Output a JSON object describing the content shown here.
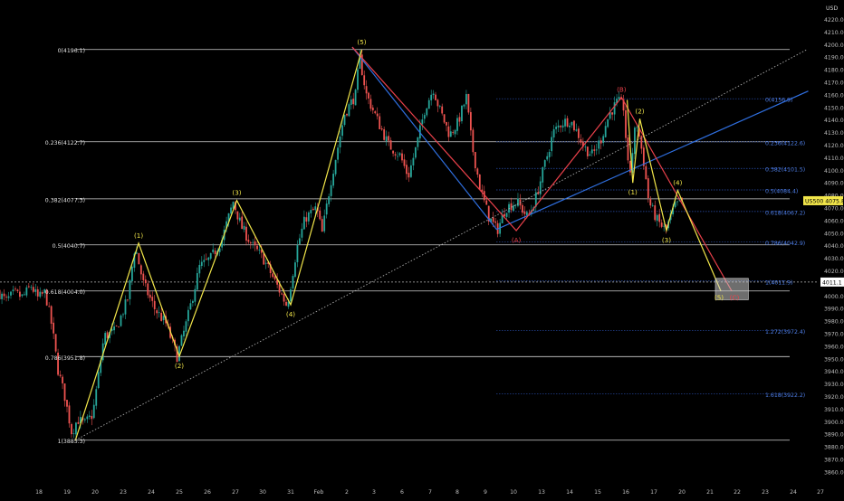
{
  "chart_data": {
    "type": "candlestick",
    "title": "",
    "xlabel": "",
    "ylabel": "",
    "currency_label": "USD",
    "symbol_label": "US500",
    "ylim": [
      3855,
      4228
    ],
    "y_ticks": [
      "3860.0",
      "3870.0",
      "3880.0",
      "3890.0",
      "3900.0",
      "3910.0",
      "3920.0",
      "3930.0",
      "3940.0",
      "3950.0",
      "3960.0",
      "3970.0",
      "3980.0",
      "3990.0",
      "4000.0",
      "4010.0",
      "4020.0",
      "4030.0",
      "4040.0",
      "4050.0",
      "4060.0",
      "4070.0",
      "4080.0",
      "4090.0",
      "4100.0",
      "4110.0",
      "4120.0",
      "4130.0",
      "4140.0",
      "4150.0",
      "4160.0",
      "4170.0",
      "4180.0",
      "4190.0",
      "4200.0",
      "4210.0",
      "4220.0"
    ],
    "x_ticks": [
      {
        "label": "18",
        "day": 0
      },
      {
        "label": "19",
        "day": 1
      },
      {
        "label": "20",
        "day": 2
      },
      {
        "label": "23",
        "day": 3
      },
      {
        "label": "24",
        "day": 4
      },
      {
        "label": "25",
        "day": 5
      },
      {
        "label": "26",
        "day": 6
      },
      {
        "label": "27",
        "day": 7
      },
      {
        "label": "30",
        "day": 8
      },
      {
        "label": "31",
        "day": 9
      },
      {
        "label": "Feb",
        "day": 10
      },
      {
        "label": "2",
        "day": 11
      },
      {
        "label": "3",
        "day": 12
      },
      {
        "label": "6",
        "day": 13
      },
      {
        "label": "7",
        "day": 14
      },
      {
        "label": "8",
        "day": 15
      },
      {
        "label": "9",
        "day": 16
      },
      {
        "label": "10",
        "day": 17
      },
      {
        "label": "13",
        "day": 18
      },
      {
        "label": "14",
        "day": 19
      },
      {
        "label": "15",
        "day": 20
      },
      {
        "label": "16",
        "day": 21
      },
      {
        "label": "17",
        "day": 22
      },
      {
        "label": "20",
        "day": 23
      },
      {
        "label": "21",
        "day": 24
      },
      {
        "label": "22",
        "day": 25
      },
      {
        "label": "23",
        "day": 26
      },
      {
        "label": "24",
        "day": 27
      },
      {
        "label": "27",
        "day": 28
      }
    ],
    "price_anchors": [
      [
        -1.4,
        4004
      ],
      [
        -1.1,
        3996
      ],
      [
        -0.8,
        4002
      ],
      [
        -0.5,
        3999
      ],
      [
        -0.2,
        4008
      ],
      [
        0.05,
        3998
      ],
      [
        0.3,
        4003
      ],
      [
        0.55,
        3975
      ],
      [
        0.75,
        3942
      ],
      [
        1.0,
        3920
      ],
      [
        1.25,
        3891
      ],
      [
        1.45,
        3902
      ],
      [
        1.7,
        3898
      ],
      [
        2.0,
        3906
      ],
      [
        2.4,
        3968
      ],
      [
        2.8,
        3972
      ],
      [
        3.25,
        3998
      ],
      [
        3.5,
        4040
      ],
      [
        3.8,
        4010
      ],
      [
        4.2,
        3990
      ],
      [
        4.6,
        3978
      ],
      [
        5.0,
        3952
      ],
      [
        5.35,
        3980
      ],
      [
        5.8,
        4023
      ],
      [
        6.2,
        4030
      ],
      [
        6.6,
        4045
      ],
      [
        7.0,
        4075
      ],
      [
        7.3,
        4055
      ],
      [
        7.7,
        4040
      ],
      [
        8.1,
        4030
      ],
      [
        8.6,
        4008
      ],
      [
        8.95,
        3992
      ],
      [
        9.3,
        4038
      ],
      [
        9.6,
        4062
      ],
      [
        10.0,
        4070
      ],
      [
        10.2,
        4050
      ],
      [
        10.5,
        4090
      ],
      [
        11.0,
        4145
      ],
      [
        11.4,
        4160
      ],
      [
        11.55,
        4190
      ],
      [
        11.8,
        4160
      ],
      [
        12.2,
        4140
      ],
      [
        12.6,
        4120
      ],
      [
        13.0,
        4112
      ],
      [
        13.3,
        4095
      ],
      [
        13.6,
        4120
      ],
      [
        13.9,
        4150
      ],
      [
        14.2,
        4165
      ],
      [
        14.4,
        4150
      ],
      [
        14.8,
        4128
      ],
      [
        15.1,
        4138
      ],
      [
        15.4,
        4158
      ],
      [
        15.6,
        4120
      ],
      [
        15.9,
        4085
      ],
      [
        16.2,
        4063
      ],
      [
        16.5,
        4052
      ],
      [
        16.8,
        4070
      ],
      [
        17.2,
        4075
      ],
      [
        17.6,
        4062
      ],
      [
        17.9,
        4080
      ],
      [
        18.2,
        4105
      ],
      [
        18.5,
        4130
      ],
      [
        18.8,
        4138
      ],
      [
        19.1,
        4140
      ],
      [
        19.4,
        4128
      ],
      [
        19.6,
        4118
      ],
      [
        19.9,
        4112
      ],
      [
        20.2,
        4125
      ],
      [
        20.5,
        4145
      ],
      [
        20.8,
        4155
      ],
      [
        21.0,
        4150
      ],
      [
        21.2,
        4092
      ],
      [
        21.45,
        4140
      ],
      [
        21.7,
        4110
      ],
      [
        21.9,
        4075
      ],
      [
        22.2,
        4060
      ],
      [
        22.5,
        4052
      ],
      [
        22.8,
        4070
      ],
      [
        23.0,
        4075
      ]
    ],
    "elliovt_wave_labels": [],
    "primary_wave": {
      "color": "#f2e64a",
      "points": [
        {
          "day": 1.3,
          "price": 3885.3,
          "label": ""
        },
        {
          "day": 3.55,
          "price": 4042,
          "label": "(1)"
        },
        {
          "day": 5.0,
          "price": 3952,
          "label": "(2)"
        },
        {
          "day": 7.05,
          "price": 4076,
          "label": "(3)"
        },
        {
          "day": 9.0,
          "price": 3993,
          "label": "(4)"
        },
        {
          "day": 11.55,
          "price": 4196,
          "label": "(5)"
        }
      ]
    },
    "subwave": {
      "color": "#f2e64a",
      "points": [
        {
          "day": 21.05,
          "price": 4156,
          "label": ""
        },
        {
          "day": 21.25,
          "price": 4090,
          "label": "(1)"
        },
        {
          "day": 21.5,
          "price": 4141,
          "label": "(2)"
        },
        {
          "day": 22.45,
          "price": 4052,
          "label": "(3)"
        },
        {
          "day": 22.85,
          "price": 4084,
          "label": "(4)"
        },
        {
          "day": 24.4,
          "price": 4004,
          "label": "(5)"
        }
      ]
    },
    "abc_wave": {
      "color": "#e8404a",
      "points": [
        {
          "day": 11.2,
          "price": 4198,
          "label": ""
        },
        {
          "day": 17.1,
          "price": 4052,
          "label": "(A)"
        },
        {
          "day": 20.85,
          "price": 4158,
          "label": "(B)"
        },
        {
          "day": 24.8,
          "price": 4004,
          "label": "(C)"
        }
      ]
    },
    "blue_wave": {
      "color": "#2f6fe0",
      "points": [
        {
          "day": 11.2,
          "price": 4198
        },
        {
          "day": 16.4,
          "price": 4053
        },
        {
          "day": 27.55,
          "price": 4163
        }
      ]
    },
    "trendline": {
      "color": "#aaaaaa",
      "from": {
        "day": 1.3,
        "price": 3885.3
      },
      "to": {
        "day": 27.5,
        "price": 4196
      }
    },
    "fib_retracement": [
      {
        "label": "0(4196.1)",
        "price": 4196.1
      },
      {
        "label": "0.236(4122.7)",
        "price": 4122.7
      },
      {
        "label": "0.382(4077.3)",
        "price": 4077.3
      },
      {
        "label": "0.5(4040.7)",
        "price": 4040.7
      },
      {
        "label": "0.618(4004.0)",
        "price": 4004.0
      },
      {
        "label": "0.786(3951.8)",
        "price": 3951.8
      },
      {
        "label": "1(3885.3)",
        "price": 3885.3
      }
    ],
    "fib_extension": [
      {
        "label": "0(4156.9)",
        "price": 4156.9
      },
      {
        "label": "0.236(4122.6)",
        "price": 4122.6
      },
      {
        "label": "0.382(4101.5)",
        "price": 4101.5
      },
      {
        "label": "0.5(4084.4)",
        "price": 4084.4
      },
      {
        "label": "0.618(4067.2)",
        "price": 4067.2
      },
      {
        "label": "0.786(4042.9)",
        "price": 4042.9
      },
      {
        "label": "1(4011.9)",
        "price": 4011.9
      },
      {
        "label": "1.272(3972.4)",
        "price": 3972.4
      },
      {
        "label": "1.618(3922.2)",
        "price": 3922.2
      }
    ],
    "current_price": {
      "value": 4011.1,
      "label": "4011.1"
    },
    "symbol_price_badge": {
      "text": "US500 4075.8",
      "price": 4075.8
    },
    "target_box": {
      "day_from": 24.2,
      "day_to": 25.4,
      "price_from": 3997,
      "price_to": 4014
    }
  }
}
